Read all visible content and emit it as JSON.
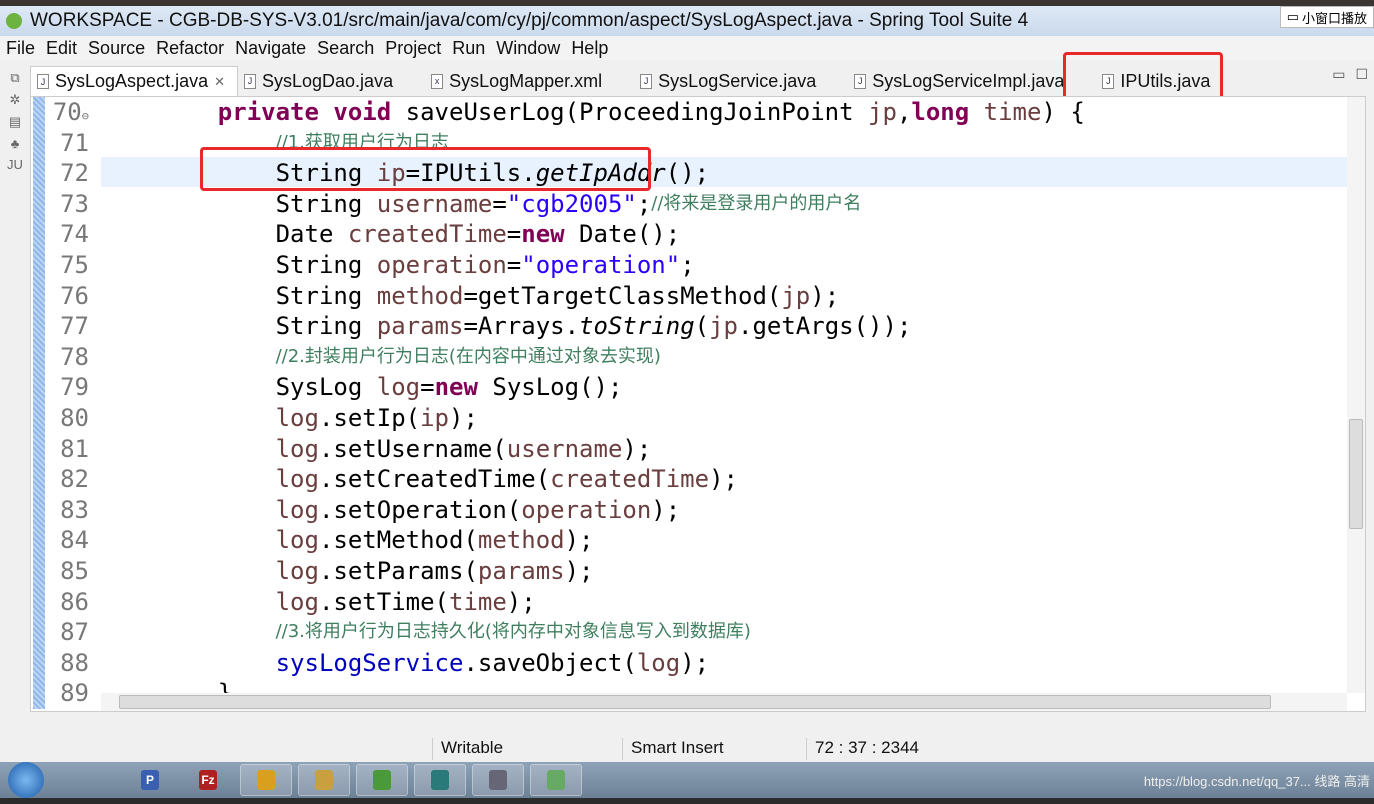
{
  "window": {
    "title": "WORKSPACE - CGB-DB-SYS-V3.01/src/main/java/com/cy/pj/common/aspect/SysLogAspect.java - Spring Tool Suite 4",
    "pip_label": "小窗口播放"
  },
  "menu": [
    "File",
    "Edit",
    "Source",
    "Refactor",
    "Navigate",
    "Search",
    "Project",
    "Run",
    "Window",
    "Help"
  ],
  "tabs": [
    {
      "label": "SysLogAspect.java",
      "icon": "java-file-icon",
      "active": true,
      "close": "✕"
    },
    {
      "label": "SysLogDao.java",
      "icon": "java-file-icon"
    },
    {
      "label": "SysLogMapper.xml",
      "icon": "xml-file-icon"
    },
    {
      "label": "SysLogService.java",
      "icon": "java-file-icon"
    },
    {
      "label": "SysLogServiceImpl.java",
      "icon": "java-file-icon"
    },
    {
      "label": "IPUtils.java",
      "icon": "java-file-icon",
      "highlighted": true
    }
  ],
  "highlight_color": "#e8282b",
  "code": [
    {
      "n": "70",
      "fold": "⊖",
      "t": [
        [
          "p",
          "    "
        ],
        [
          "k",
          "private"
        ],
        [
          "p",
          " "
        ],
        [
          "k",
          "void"
        ],
        [
          "p",
          " saveUserLog(ProceedingJoinPoint "
        ],
        [
          "v",
          "jp"
        ],
        [
          "p",
          ","
        ],
        [
          "k",
          "long"
        ],
        [
          "p",
          " "
        ],
        [
          "v",
          "time"
        ],
        [
          "p",
          ") {"
        ]
      ]
    },
    {
      "n": "71",
      "t": [
        [
          "p",
          "        "
        ],
        [
          "c",
          "//1.获取用户行为日志"
        ]
      ]
    },
    {
      "n": "72",
      "t": [
        [
          "p",
          "        String "
        ],
        [
          "v",
          "ip"
        ],
        [
          "p",
          "=IPUtils."
        ],
        [
          "i",
          "getIpAddr"
        ],
        [
          "p",
          "();"
        ]
      ]
    },
    {
      "n": "73",
      "t": [
        [
          "p",
          "        String "
        ],
        [
          "v",
          "username"
        ],
        [
          "p",
          "="
        ],
        [
          "s",
          "\"cgb2005\""
        ],
        [
          "p",
          ";"
        ],
        [
          "c",
          "//将来是登录用户的用户名"
        ]
      ]
    },
    {
      "n": "74",
      "t": [
        [
          "p",
          "        Date "
        ],
        [
          "v",
          "createdTime"
        ],
        [
          "p",
          "="
        ],
        [
          "k",
          "new"
        ],
        [
          "p",
          " Date();"
        ]
      ]
    },
    {
      "n": "75",
      "t": [
        [
          "p",
          "        String "
        ],
        [
          "v",
          "operation"
        ],
        [
          "p",
          "="
        ],
        [
          "s",
          "\"operation\""
        ],
        [
          "p",
          ";"
        ]
      ]
    },
    {
      "n": "76",
      "t": [
        [
          "p",
          "        String "
        ],
        [
          "v",
          "method"
        ],
        [
          "p",
          "=getTargetClassMethod("
        ],
        [
          "v",
          "jp"
        ],
        [
          "p",
          ");"
        ]
      ]
    },
    {
      "n": "77",
      "t": [
        [
          "p",
          "        String "
        ],
        [
          "v",
          "params"
        ],
        [
          "p",
          "=Arrays."
        ],
        [
          "i",
          "toString"
        ],
        [
          "p",
          "("
        ],
        [
          "v",
          "jp"
        ],
        [
          "p",
          ".getArgs());"
        ]
      ]
    },
    {
      "n": "78",
      "t": [
        [
          "p",
          "        "
        ],
        [
          "c",
          "//2.封装用户行为日志(在内容中通过对象去实现)"
        ]
      ]
    },
    {
      "n": "79",
      "t": [
        [
          "p",
          "        SysLog "
        ],
        [
          "v",
          "log"
        ],
        [
          "p",
          "="
        ],
        [
          "k",
          "new"
        ],
        [
          "p",
          " SysLog();"
        ]
      ]
    },
    {
      "n": "80",
      "t": [
        [
          "p",
          "        "
        ],
        [
          "v",
          "log"
        ],
        [
          "p",
          ".setIp("
        ],
        [
          "v",
          "ip"
        ],
        [
          "p",
          ");"
        ]
      ]
    },
    {
      "n": "81",
      "t": [
        [
          "p",
          "        "
        ],
        [
          "v",
          "log"
        ],
        [
          "p",
          ".setUsername("
        ],
        [
          "v",
          "username"
        ],
        [
          "p",
          ");"
        ]
      ]
    },
    {
      "n": "82",
      "t": [
        [
          "p",
          "        "
        ],
        [
          "v",
          "log"
        ],
        [
          "p",
          ".setCreatedTime("
        ],
        [
          "v",
          "createdTime"
        ],
        [
          "p",
          ");"
        ]
      ]
    },
    {
      "n": "83",
      "t": [
        [
          "p",
          "        "
        ],
        [
          "v",
          "log"
        ],
        [
          "p",
          ".setOperation("
        ],
        [
          "v",
          "operation"
        ],
        [
          "p",
          ");"
        ]
      ]
    },
    {
      "n": "84",
      "t": [
        [
          "p",
          "        "
        ],
        [
          "v",
          "log"
        ],
        [
          "p",
          ".setMethod("
        ],
        [
          "v",
          "method"
        ],
        [
          "p",
          ");"
        ]
      ]
    },
    {
      "n": "85",
      "t": [
        [
          "p",
          "        "
        ],
        [
          "v",
          "log"
        ],
        [
          "p",
          ".setParams("
        ],
        [
          "v",
          "params"
        ],
        [
          "p",
          ");"
        ]
      ]
    },
    {
      "n": "86",
      "t": [
        [
          "p",
          "        "
        ],
        [
          "v",
          "log"
        ],
        [
          "p",
          ".setTime("
        ],
        [
          "v",
          "time"
        ],
        [
          "p",
          ");"
        ]
      ]
    },
    {
      "n": "87",
      "t": [
        [
          "p",
          "        "
        ],
        [
          "c",
          "//3.将用户行为日志持久化(将内存中对象信息写入到数据库)"
        ]
      ]
    },
    {
      "n": "88",
      "t": [
        [
          "p",
          "        "
        ],
        [
          "f",
          "sysLogService"
        ],
        [
          "p",
          ".saveObject("
        ],
        [
          "v",
          "log"
        ],
        [
          "p",
          ");"
        ]
      ]
    },
    {
      "n": "89",
      "t": [
        [
          "p",
          "    }"
        ]
      ]
    }
  ],
  "status": {
    "mode": "Writable",
    "insert": "Smart Insert",
    "position": "72 : 37 : 2344"
  },
  "taskbar": {
    "apps": [
      "P",
      "Fz",
      "chrome",
      "files",
      "spring",
      "editor",
      "net",
      "wechat"
    ],
    "tray": "https://blog.csdn.net/qq_37... 线路 高清"
  }
}
